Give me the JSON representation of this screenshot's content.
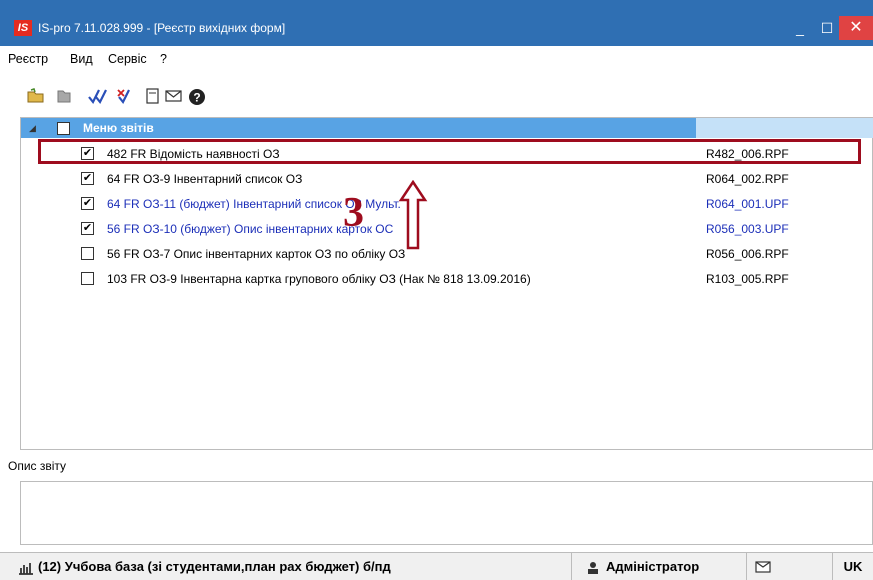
{
  "window": {
    "app_logo": "IS",
    "title": "IS-pro 7.11.028.999 - [Реєстр вихідних форм]",
    "minimize": "_",
    "maximize": "☐",
    "close": "✕"
  },
  "menu": [
    "Реєстр",
    "Вид",
    "Сервіс",
    "?"
  ],
  "toolbar": {
    "icons": [
      "folder-open-icon",
      "folder-icon",
      "check-all-icon",
      "uncheck-all-icon",
      "page-icon",
      "mail-icon",
      "help-icon"
    ]
  },
  "tree": {
    "root_label": "Меню звітів",
    "rows": [
      {
        "checked": true,
        "name": "482 FR Відомість наявності ОЗ",
        "file": "R482_006.RPF",
        "blue": false
      },
      {
        "checked": true,
        "name": "64 FR ОЗ-9 Інвентарний список ОЗ",
        "file": "R064_002.RPF",
        "blue": false
      },
      {
        "checked": true,
        "name": "64 FR ОЗ-11 (бюджет) Інвентарний список ОЗ Мульт.",
        "file": "R064_001.UPF",
        "blue": true
      },
      {
        "checked": true,
        "name": "56 FR ОЗ-10 (бюджет) Опис інвентарних карток ОС",
        "file": "R056_003.UPF",
        "blue": true
      },
      {
        "checked": false,
        "name": "56 FR ОЗ-7 Опис інвентарних карток ОЗ по обліку ОЗ",
        "file": "R056_006.RPF",
        "blue": false
      },
      {
        "checked": false,
        "name": "103 FR ОЗ-9 Інвентарна картка групового обліку ОЗ (Нак № 818 13.09.2016)",
        "file": "R103_005.RPF",
        "blue": false
      }
    ]
  },
  "annotation": {
    "number": "3"
  },
  "description": {
    "label": "Опис звіту",
    "value": ""
  },
  "status": {
    "database": "(12) Учбова база (зі студентами,план рах бюджет) б/пд",
    "user": "Адміністратор",
    "lang": "UK"
  },
  "colors": {
    "titlebar": "#2f6fb3",
    "tree_header": "#58a3e4",
    "highlight": "#9e0c1e",
    "close": "#e04343"
  }
}
